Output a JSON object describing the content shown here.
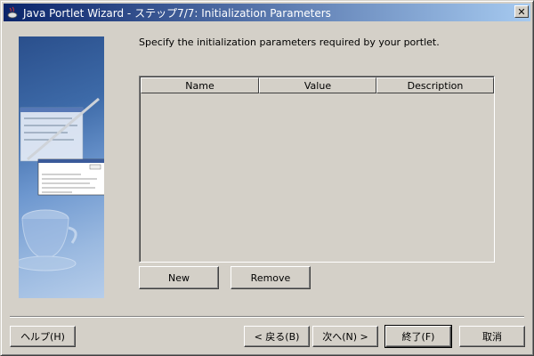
{
  "window": {
    "title": "Java Portlet Wizard - ステップ7/7: Initialization Parameters",
    "app_icon": "java-cup-icon",
    "close_icon": "close-icon",
    "close_glyph": "✕"
  },
  "main": {
    "instruction": "Specify the initialization parameters required by your portlet.",
    "table": {
      "columns": [
        "Name",
        "Value",
        "Description"
      ],
      "rows": []
    },
    "buttons": {
      "new": "New",
      "remove": "Remove"
    }
  },
  "footer": {
    "help": "ヘルプ(H)",
    "back": "< 戻る(B)",
    "next": "次へ(N) >",
    "finish": "終了(F)",
    "cancel": "取消"
  }
}
